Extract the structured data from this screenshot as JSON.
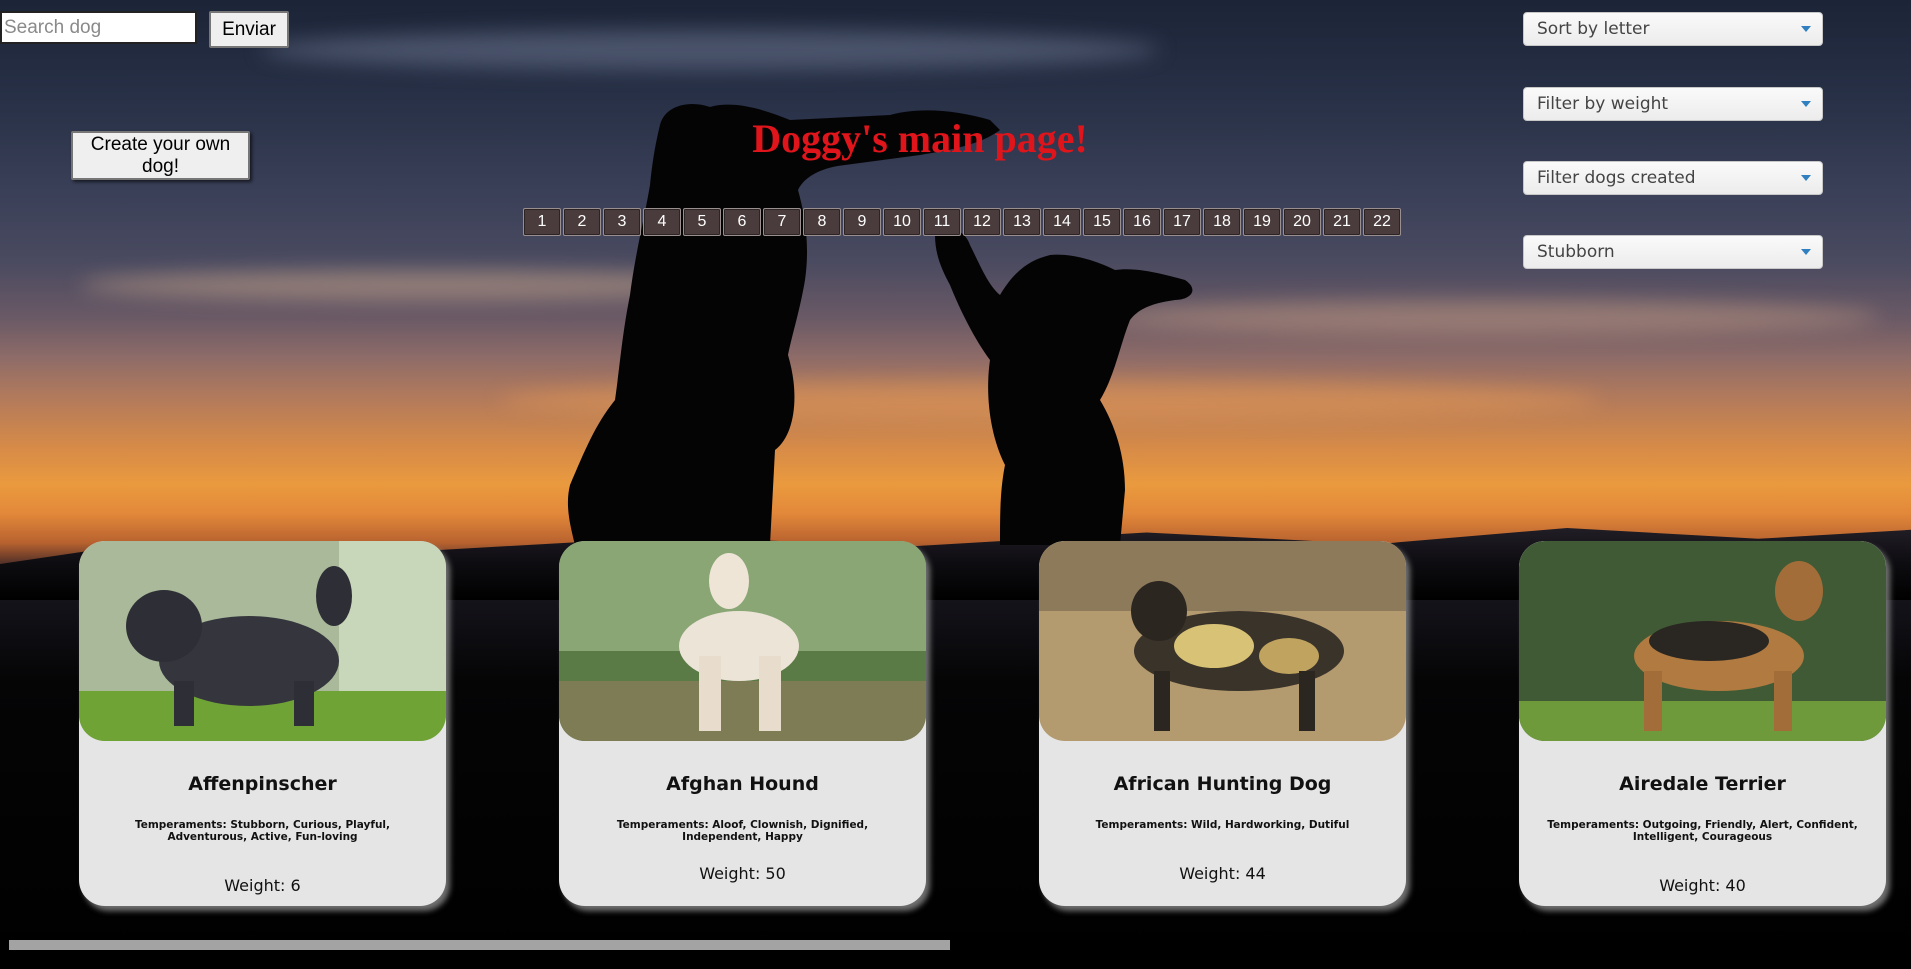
{
  "search": {
    "placeholder": "Search dog",
    "button_label": "Enviar"
  },
  "create_button_label": "Create your own dog!",
  "title": "Doggy's main page!",
  "pagination": [
    "1",
    "2",
    "3",
    "4",
    "5",
    "6",
    "7",
    "8",
    "9",
    "10",
    "11",
    "12",
    "13",
    "14",
    "15",
    "16",
    "17",
    "18",
    "19",
    "20",
    "21",
    "22"
  ],
  "filters": {
    "sort": "Sort by letter",
    "weight": "Filter by weight",
    "created": "Filter dogs created",
    "temperament": "Stubborn"
  },
  "cards": [
    {
      "name": "Affenpinscher",
      "temperaments": "Temperaments: Stubborn, Curious, Playful, Adventurous, Active, Fun-loving",
      "weight": "Weight: 6"
    },
    {
      "name": "Afghan Hound",
      "temperaments": "Temperaments: Aloof, Clownish, Dignified, Independent, Happy",
      "weight": "Weight: 50"
    },
    {
      "name": "African Hunting Dog",
      "temperaments": "Temperaments: Wild, Hardworking, Dutiful",
      "weight": "Weight: 44"
    },
    {
      "name": "Airedale Terrier",
      "temperaments": "Temperaments: Outgoing, Friendly, Alert, Confident, Intelligent, Courageous",
      "weight": "Weight: 40"
    }
  ],
  "colors": {
    "title": "#e0151b",
    "page_button": "#4a3c3c",
    "card_bg": "#e5e5e5",
    "select_caret": "#2f7fc1"
  }
}
